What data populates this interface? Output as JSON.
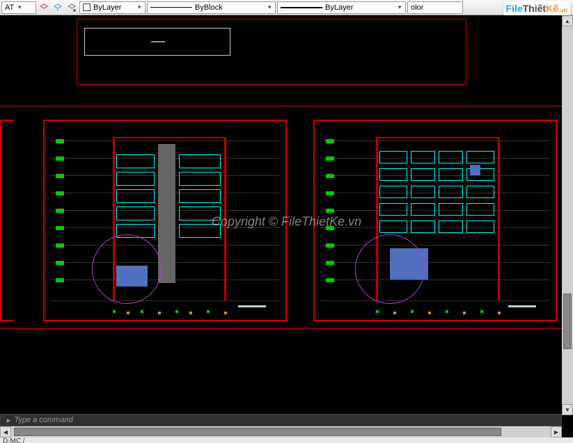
{
  "toolbar": {
    "layer_combo_suffix": "AT",
    "color_label": "ByLayer",
    "linetype_label": "ByBlock",
    "lineweight_label": "ByLayer",
    "plot_style_partial": "olor"
  },
  "watermark": {
    "file": "File",
    "thiet": "Thiết",
    "ke": "Kế",
    "vn": ".vn"
  },
  "command_line": {
    "placeholder": "Type a command"
  },
  "status_bar": {
    "tab": "D-MC  /"
  },
  "copyright_text": "Copyright © FileThietKe.vn",
  "icons": {
    "layer": "⬚",
    "isolate": "⬛",
    "filter": "⬗"
  }
}
